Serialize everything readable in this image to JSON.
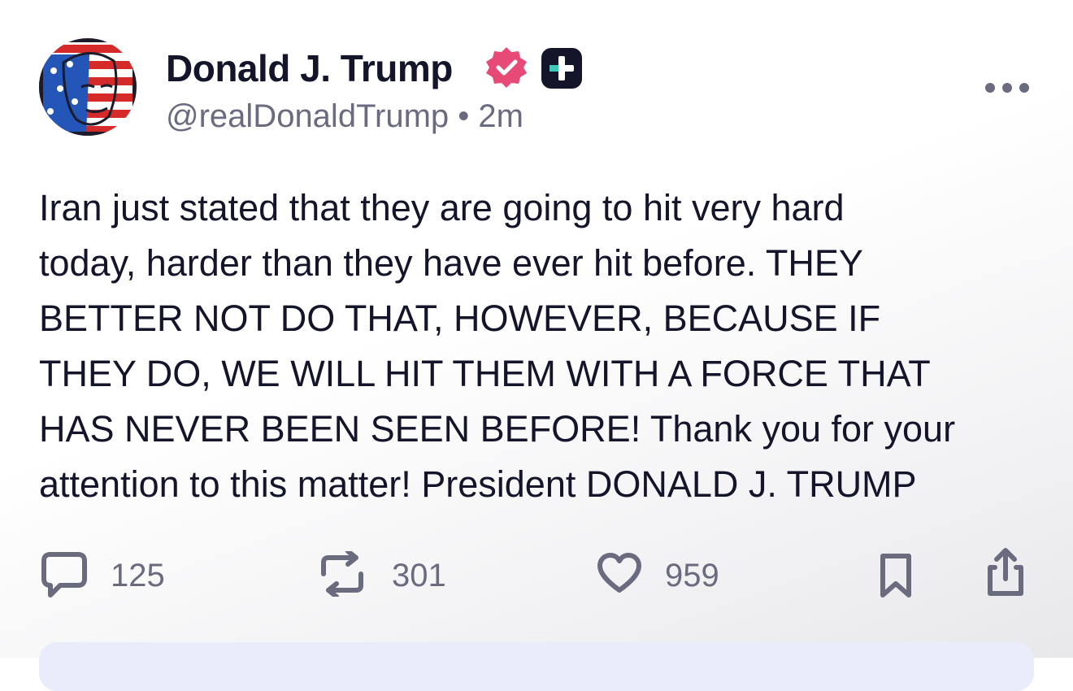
{
  "author": {
    "name": "Donald J. Trump",
    "handle": "@realDonaldTrump",
    "separator": "•",
    "time": "2m",
    "verified_color": "#e84a77",
    "badge": "plus-badge-icon"
  },
  "post": {
    "text": "Iran just stated that they are going to hit very hard\ntoday, harder than they have ever hit before. THEY\nBETTER NOT DO THAT, HOWEVER, BECAUSE IF\nTHEY DO, WE WILL HIT THEM WITH A FORCE THAT\nHAS NEVER BEEN SEEN BEFORE! Thank you for your\nattention to this matter! President DONALD J. TRUMP"
  },
  "actions": {
    "replies": "125",
    "reposts": "301",
    "likes": "959",
    "icon_color": "#6b6b80"
  }
}
